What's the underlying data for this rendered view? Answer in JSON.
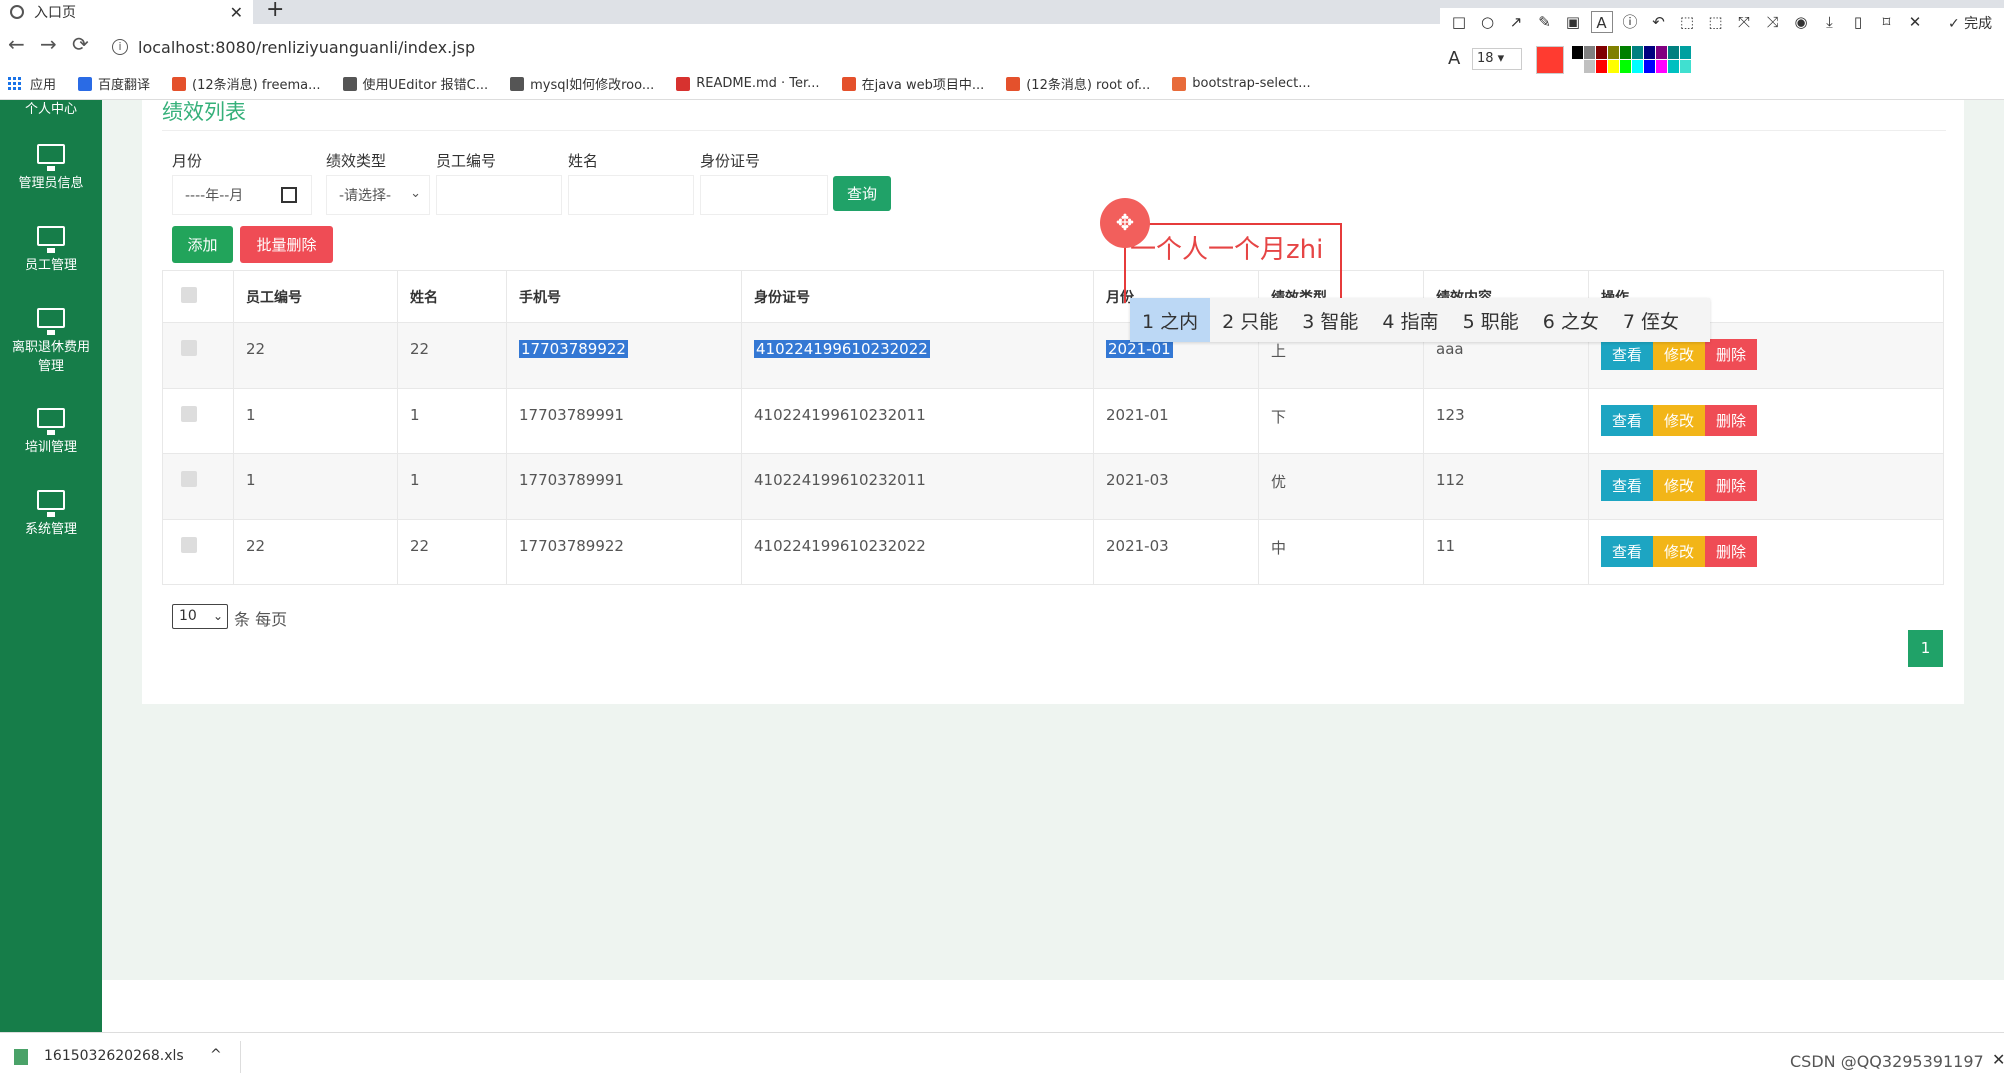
{
  "browser": {
    "tab_title": "入口页",
    "tab_close": "✕",
    "new_tab": "+",
    "back": "←",
    "forward": "→",
    "reload": "⟳",
    "url": "localhost:8080/renliziyuanguanli/index.jsp",
    "star": "☆",
    "menu": "⋮",
    "bookmarks": [
      {
        "label": "应用",
        "color": "#1a73e8",
        "icon": "apps-icon"
      },
      {
        "label": "百度翻译",
        "color": "#2a6be5",
        "icon": "baidu-translate-icon"
      },
      {
        "label": "(12条消息) freema...",
        "color": "#e4512c",
        "icon": "csdn-icon"
      },
      {
        "label": "使用UEditor 报错C...",
        "color": "#555555",
        "icon": "ueditor-icon"
      },
      {
        "label": "mysql如何修改roo...",
        "color": "#555555",
        "icon": "ueditor-icon"
      },
      {
        "label": "README.md · Ter...",
        "color": "#d7322f",
        "icon": "gitee-icon"
      },
      {
        "label": "在java web项目中...",
        "color": "#e4512c",
        "icon": "csdn-icon"
      },
      {
        "label": "(12条消息) root of...",
        "color": "#e4512c",
        "icon": "csdn-icon"
      },
      {
        "label": "bootstrap-select...",
        "color": "#e86b3a",
        "icon": "bookmark-icon"
      }
    ]
  },
  "annotation_toolbar": {
    "tools": [
      "□",
      "○",
      "↗",
      "✎",
      "▣",
      "A",
      "ⓘ",
      "↶",
      "⬚",
      "⬚",
      "⤧",
      "⤨",
      "◉",
      "⤓",
      "▯",
      "⌑",
      "✕"
    ],
    "done_label": "✓ 完成",
    "font_label": "A",
    "font_size": "18",
    "current_color": "#ff3b30",
    "palette": [
      "#000000",
      "#808080",
      "#800000",
      "#808000",
      "#008000",
      "#008080",
      "#000080",
      "#800080",
      "#008080",
      "#00a0a0",
      "#ffffff",
      "#c0c0c0",
      "#ff0000",
      "#ffff00",
      "#00ff00",
      "#00ffff",
      "#0000ff",
      "#ff00ff",
      "#00c0c0",
      "#40e0d0"
    ]
  },
  "sidebar": {
    "items": [
      {
        "label": "个人中心"
      },
      {
        "label": "管理员信息"
      },
      {
        "label": "员工管理"
      },
      {
        "label": "离职退休费用管理"
      },
      {
        "label": "培训管理"
      },
      {
        "label": "系统管理"
      }
    ]
  },
  "page": {
    "title": "绩效列表",
    "filters": {
      "month_label": "月份",
      "month_value": "----年--月",
      "type_label": "绩效类型",
      "type_value": "-请选择-",
      "emp_no_label": "员工编号",
      "name_label": "姓名",
      "id_label": "身份证号",
      "query_button": "查询"
    },
    "add_button": "添加",
    "batch_delete_button": "批量删除",
    "table": {
      "headers": [
        "",
        "员工编号",
        "姓名",
        "手机号",
        "身份证号",
        "月份",
        "绩效类型",
        "绩效内容",
        "操作"
      ],
      "rows": [
        {
          "emp_no": "22",
          "name": "22",
          "phone": "17703789922",
          "id": "410224199610232022",
          "month": "2021-01",
          "type": "上",
          "content": "aaa"
        },
        {
          "emp_no": "1",
          "name": "1",
          "phone": "17703789991",
          "id": "410224199610232011",
          "month": "2021-01",
          "type": "下",
          "content": "123"
        },
        {
          "emp_no": "1",
          "name": "1",
          "phone": "17703789991",
          "id": "410224199610232011",
          "month": "2021-03",
          "type": "优",
          "content": "112"
        },
        {
          "emp_no": "22",
          "name": "22",
          "phone": "17703789922",
          "id": "410224199610232022",
          "month": "2021-03",
          "type": "中",
          "content": "11"
        }
      ],
      "view_label": "查看",
      "edit_label": "修改",
      "delete_label": "删除"
    },
    "page_size": "10",
    "page_size_suffix": "条 每页",
    "current_page": "1"
  },
  "annotation": {
    "text": "一个人一个月zhi",
    "move_icon": "✥",
    "ime_candidates": [
      "1 之内",
      "2 只能",
      "3 智能",
      "4 指南",
      "5 职能",
      "6 之女",
      "7 侄女"
    ]
  },
  "downloads": {
    "file": "1615032620268.xls",
    "chevron": "^",
    "close": "✕"
  },
  "watermark": "CSDN @QQ3295391197"
}
